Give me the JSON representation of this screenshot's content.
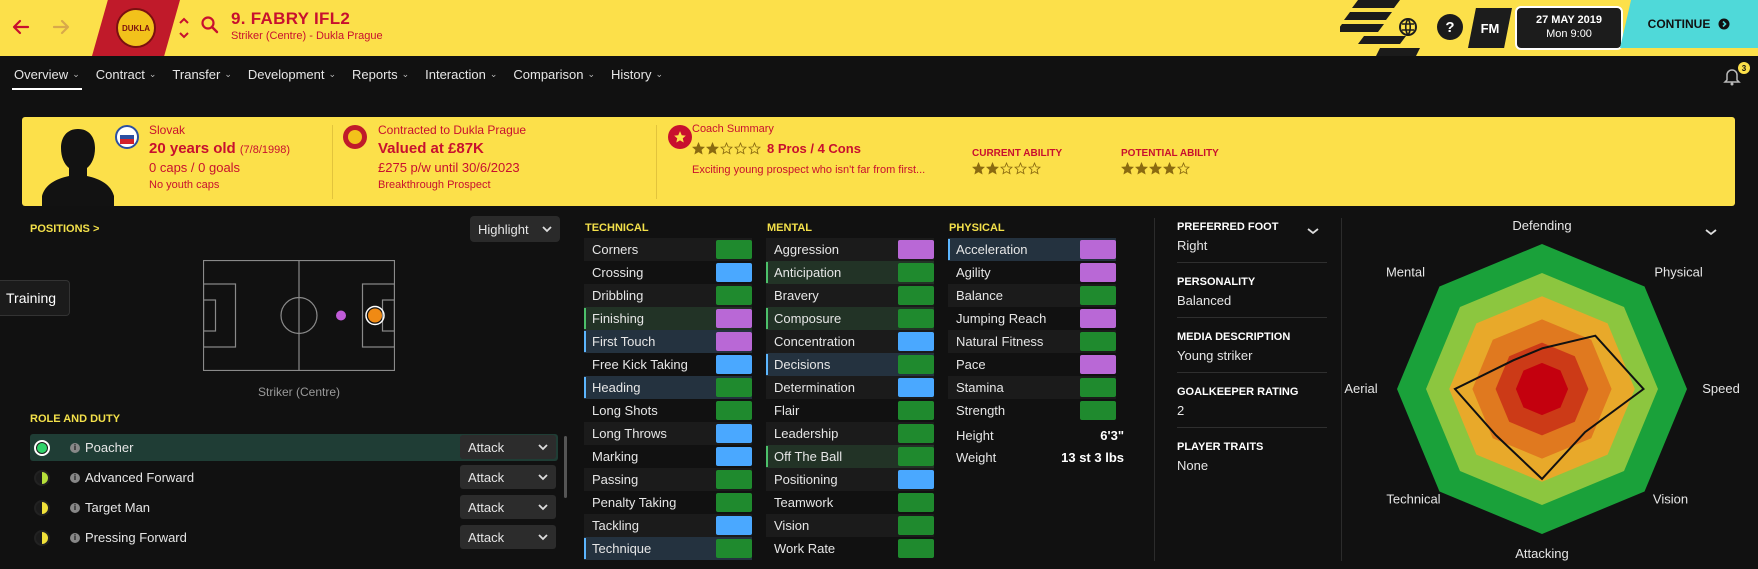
{
  "header": {
    "player_name": "9. FABRY IFL2",
    "player_subtitle": "Striker (Centre) - Dukla Prague",
    "club_badge_text": "DUKLA",
    "date": "27 MAY 2019",
    "time": "Mon 9:00",
    "fm_label": "FM",
    "continue_label": "CONTINUE",
    "notification_count": "3"
  },
  "tabs": [
    {
      "label": "Overview"
    },
    {
      "label": "Contract"
    },
    {
      "label": "Transfer"
    },
    {
      "label": "Development"
    },
    {
      "label": "Reports"
    },
    {
      "label": "Interaction"
    },
    {
      "label": "Comparison"
    },
    {
      "label": "History"
    }
  ],
  "banner": {
    "nationality": "Slovak",
    "age": "20 years old",
    "dob": "(7/8/1998)",
    "caps": "0 caps / 0 goals",
    "youth_caps": "No youth caps",
    "contract_label": "Contracted to Dukla Prague",
    "value": "Valued at £87K",
    "wage": "£275 p/w until 30/6/2023",
    "prospect": "Breakthrough Prospect",
    "coach_label": "Coach Summary",
    "pros_cons": "8 Pros / 4 Cons",
    "coach_text": "Exciting young prospect who isn't far from first...",
    "coach_stars": 2,
    "current_ability_label": "CURRENT ABILITY",
    "current_ability_stars": 2,
    "potential_ability_label": "POTENTIAL ABILITY",
    "potential_ability_stars": 4
  },
  "positions": {
    "title": "POSITIONS >",
    "highlight_label": "Highlight",
    "caption": "Striker (Centre)"
  },
  "training_label": "Training",
  "roles": {
    "title": "ROLE AND DUTY",
    "items": [
      {
        "name": "Poacher",
        "duty": "Attack",
        "color": "#2fd26a",
        "selected": true
      },
      {
        "name": "Advanced Forward",
        "duty": "Attack",
        "color": "#b7e03a",
        "selected": false
      },
      {
        "name": "Target Man",
        "duty": "Attack",
        "color": "#f2e23a",
        "selected": false
      },
      {
        "name": "Pressing Forward",
        "duty": "Attack",
        "color": "#f2e23a",
        "selected": false
      }
    ]
  },
  "colors": {
    "green": "#1f8a2e",
    "blue": "#4aa8ff",
    "purple": "#b968d6",
    "accent_yellow": "#fce04a",
    "accent_red": "#c8102e"
  },
  "technical": {
    "title": "TECHNICAL",
    "items": [
      {
        "name": "Corners",
        "color": "green",
        "hl": ""
      },
      {
        "name": "Crossing",
        "color": "blue",
        "hl": ""
      },
      {
        "name": "Dribbling",
        "color": "green",
        "hl": ""
      },
      {
        "name": "Finishing",
        "color": "purple",
        "hl": "green"
      },
      {
        "name": "First Touch",
        "color": "purple",
        "hl": "blue"
      },
      {
        "name": "Free Kick Taking",
        "color": "blue",
        "hl": ""
      },
      {
        "name": "Heading",
        "color": "green",
        "hl": "blue"
      },
      {
        "name": "Long Shots",
        "color": "green",
        "hl": ""
      },
      {
        "name": "Long Throws",
        "color": "blue",
        "hl": ""
      },
      {
        "name": "Marking",
        "color": "blue",
        "hl": ""
      },
      {
        "name": "Passing",
        "color": "green",
        "hl": ""
      },
      {
        "name": "Penalty Taking",
        "color": "green",
        "hl": ""
      },
      {
        "name": "Tackling",
        "color": "blue",
        "hl": ""
      },
      {
        "name": "Technique",
        "color": "green",
        "hl": "blue"
      }
    ]
  },
  "mental": {
    "title": "MENTAL",
    "items": [
      {
        "name": "Aggression",
        "color": "purple",
        "hl": ""
      },
      {
        "name": "Anticipation",
        "color": "green",
        "hl": "green"
      },
      {
        "name": "Bravery",
        "color": "green",
        "hl": ""
      },
      {
        "name": "Composure",
        "color": "green",
        "hl": "green"
      },
      {
        "name": "Concentration",
        "color": "blue",
        "hl": ""
      },
      {
        "name": "Decisions",
        "color": "green",
        "hl": "blue"
      },
      {
        "name": "Determination",
        "color": "blue",
        "hl": ""
      },
      {
        "name": "Flair",
        "color": "green",
        "hl": ""
      },
      {
        "name": "Leadership",
        "color": "green",
        "hl": ""
      },
      {
        "name": "Off The Ball",
        "color": "green",
        "hl": "green"
      },
      {
        "name": "Positioning",
        "color": "blue",
        "hl": ""
      },
      {
        "name": "Teamwork",
        "color": "green",
        "hl": ""
      },
      {
        "name": "Vision",
        "color": "green",
        "hl": ""
      },
      {
        "name": "Work Rate",
        "color": "green",
        "hl": ""
      }
    ]
  },
  "physical": {
    "title": "PHYSICAL",
    "items": [
      {
        "name": "Acceleration",
        "color": "purple",
        "hl": "blue"
      },
      {
        "name": "Agility",
        "color": "purple",
        "hl": ""
      },
      {
        "name": "Balance",
        "color": "green",
        "hl": ""
      },
      {
        "name": "Jumping Reach",
        "color": "purple",
        "hl": ""
      },
      {
        "name": "Natural Fitness",
        "color": "green",
        "hl": ""
      },
      {
        "name": "Pace",
        "color": "purple",
        "hl": ""
      },
      {
        "name": "Stamina",
        "color": "green",
        "hl": ""
      },
      {
        "name": "Strength",
        "color": "green",
        "hl": ""
      }
    ],
    "height_label": "Height",
    "height_value": "6'3\"",
    "weight_label": "Weight",
    "weight_value": "13 st 3 lbs"
  },
  "profile": {
    "preferred_foot_label": "PREFERRED FOOT",
    "preferred_foot": "Right",
    "personality_label": "PERSONALITY",
    "personality": "Balanced",
    "media_label": "MEDIA DESCRIPTION",
    "media": "Young striker",
    "gk_label": "GOALKEEPER RATING",
    "gk": "2",
    "traits_label": "PLAYER TRAITS",
    "traits": "None"
  },
  "radar": {
    "labels": [
      "Defending",
      "Physical",
      "Speed",
      "Vision",
      "Attacking",
      "Technical",
      "Aerial",
      "Mental"
    ],
    "player_values": [
      0.28,
      0.52,
      0.7,
      0.42,
      0.62,
      0.45,
      0.6,
      0.28
    ]
  }
}
